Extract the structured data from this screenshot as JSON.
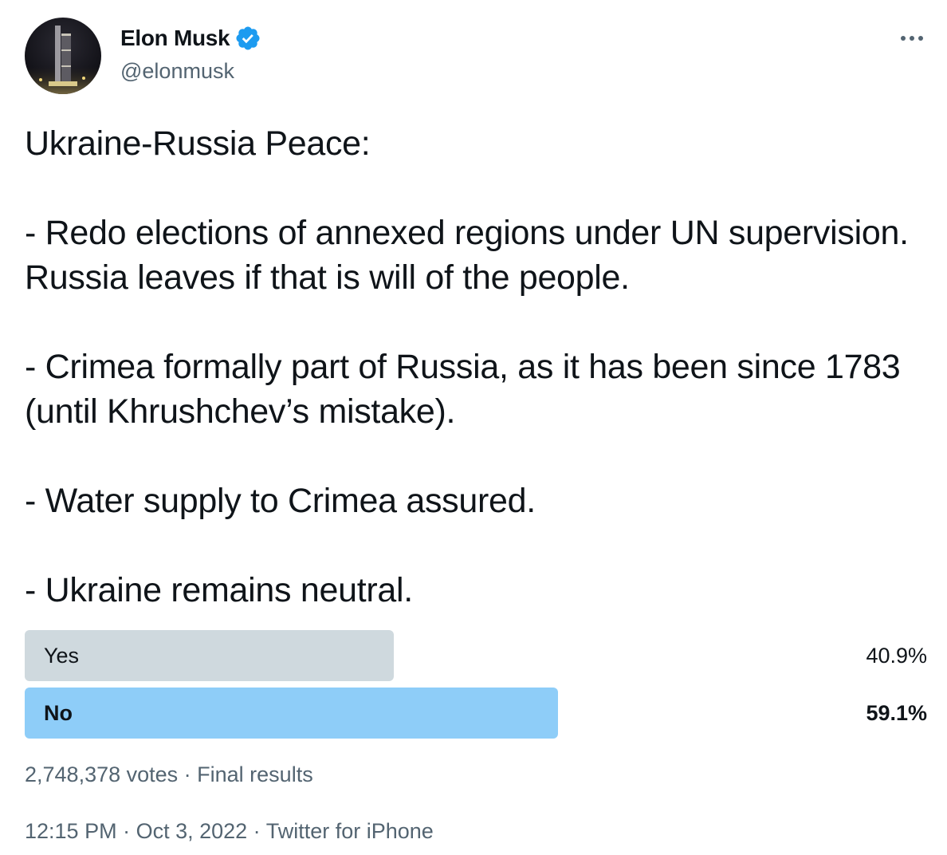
{
  "author": {
    "display_name": "Elon Musk",
    "handle": "@elonmusk",
    "verified": true,
    "verified_color": "#1d9bf0"
  },
  "tweet": {
    "lines": [
      "Ukraine-Russia Peace:",
      "",
      "- Redo elections of annexed regions under UN supervision. Russia leaves if that is will of the people.",
      "",
      "- Crimea formally part of Russia, as it has been since 1783 (until Khrushchev’s mistake).",
      "",
      "- Water supply to Crimea assured.",
      "",
      "- Ukraine remains neutral."
    ]
  },
  "poll": {
    "options": [
      {
        "label": "Yes",
        "percent_text": "40.9%",
        "percent": 40.9,
        "winner": false,
        "bar_color": "#cfd9de"
      },
      {
        "label": "No",
        "percent_text": "59.1%",
        "percent": 59.1,
        "winner": true,
        "bar_color": "#8ecdf8"
      }
    ],
    "votes_text": "2,748,378 votes",
    "separator": " · ",
    "status": "Final results"
  },
  "meta": {
    "time": "12:15 PM",
    "date": "Oct 3, 2022",
    "source": "Twitter for iPhone",
    "separator": " · "
  },
  "icons": {
    "verified": "verified-badge-icon",
    "more": "more-options-icon"
  }
}
